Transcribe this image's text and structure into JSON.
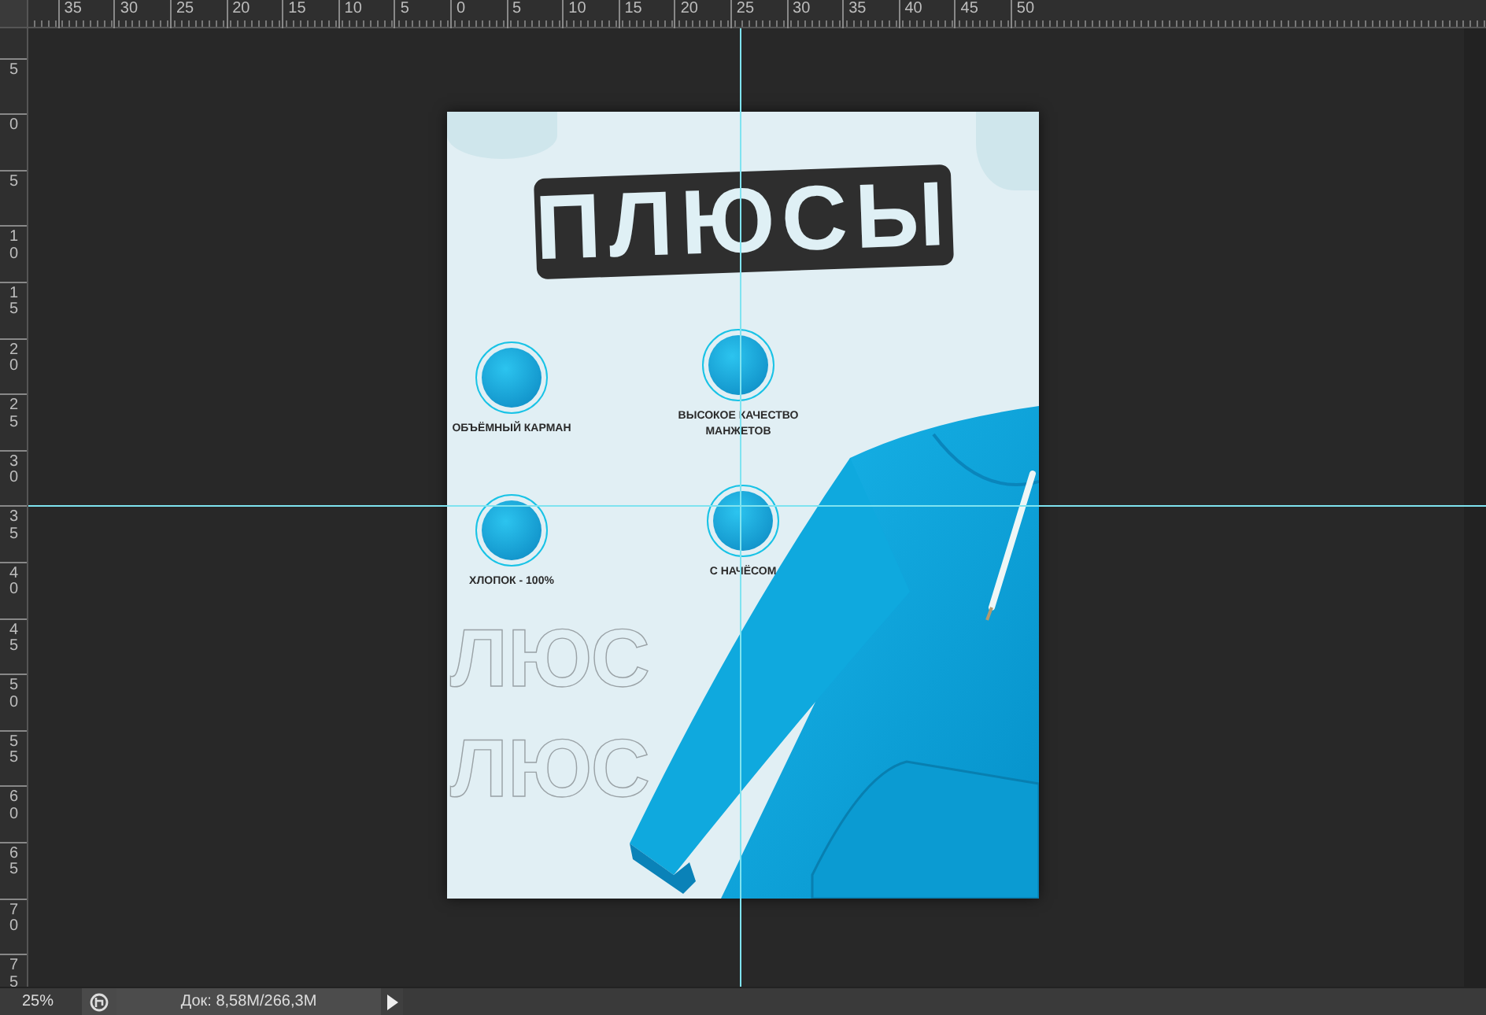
{
  "rulers": {
    "top_labels": [
      "35",
      "30",
      "25",
      "20",
      "15",
      "10",
      "5",
      "0",
      "5",
      "10",
      "15",
      "20",
      "25",
      "30",
      "35",
      "40",
      "45",
      "50"
    ],
    "left_labels": [
      "5",
      "0",
      "5",
      "10",
      "15",
      "20",
      "25",
      "30",
      "35",
      "40",
      "45",
      "50",
      "55",
      "60",
      "65",
      "70",
      "75"
    ]
  },
  "document": {
    "title": "ПЛЮСЫ",
    "features": [
      {
        "label": "ОБЪЁМНЫЙ КАРМАН"
      },
      {
        "label": "ВЫСОКОЕ КАЧЕСТВО МАНЖЕТОВ"
      },
      {
        "label": "ХЛОПОК - 100%"
      },
      {
        "label": "С НАЧЁСОМ"
      }
    ],
    "background_text": [
      "ЛЮС",
      "ЛЮС"
    ]
  },
  "status_bar": {
    "zoom": "25%",
    "doc_info": "Док: 8,58M/266,3M"
  }
}
